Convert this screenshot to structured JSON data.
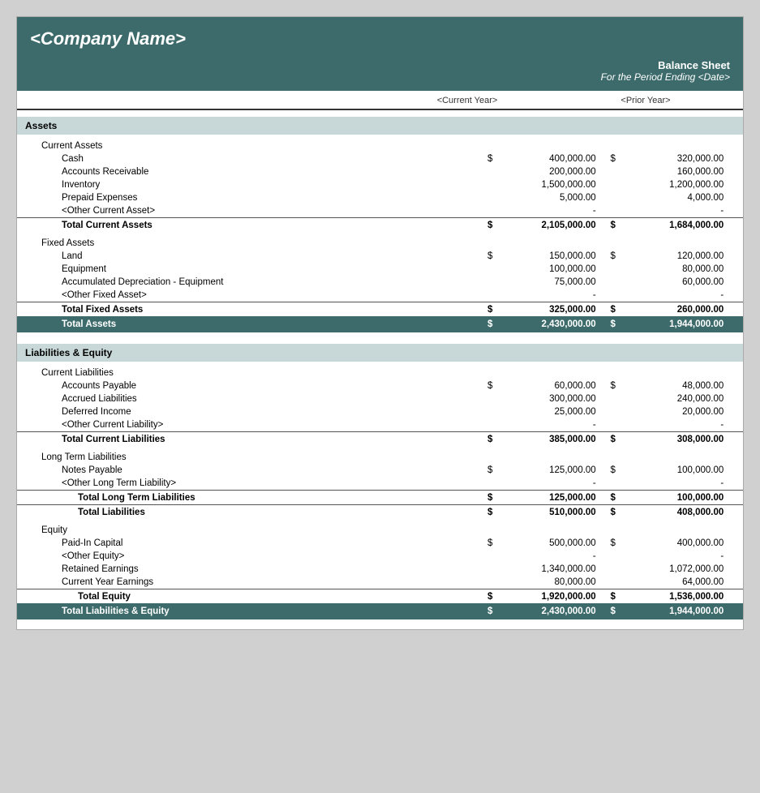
{
  "header": {
    "company_name": "<Company Name>",
    "title": "Balance Sheet",
    "subtitle": "For the Period Ending <Date>",
    "col_cy": "<Current Year>",
    "col_py": "<Prior Year>"
  },
  "sections": {
    "assets_label": "Assets",
    "liabilities_label": "Liabilities & Equity"
  },
  "assets": {
    "current_assets_label": "Current Assets",
    "items": [
      {
        "label": "Cash",
        "dollar": "$",
        "cy": "400,000.00",
        "py_dollar": "$",
        "py": "320,000.00"
      },
      {
        "label": "Accounts Receivable",
        "dollar": "",
        "cy": "200,000.00",
        "py_dollar": "",
        "py": "160,000.00"
      },
      {
        "label": "Inventory",
        "dollar": "",
        "cy": "1,500,000.00",
        "py_dollar": "",
        "py": "1,200,000.00"
      },
      {
        "label": "Prepaid Expenses",
        "dollar": "",
        "cy": "5,000.00",
        "py_dollar": "",
        "py": "4,000.00"
      },
      {
        "label": "<Other Current Asset>",
        "dollar": "",
        "cy": "-",
        "py_dollar": "",
        "py": "-"
      }
    ],
    "total_current": {
      "label": "Total Current Assets",
      "dollar": "$",
      "cy": "2,105,000.00",
      "py_dollar": "$",
      "py": "1,684,000.00"
    },
    "fixed_assets_label": "Fixed Assets",
    "fixed_items": [
      {
        "label": "Land",
        "dollar": "$",
        "cy": "150,000.00",
        "py_dollar": "$",
        "py": "120,000.00"
      },
      {
        "label": "Equipment",
        "dollar": "",
        "cy": "100,000.00",
        "py_dollar": "",
        "py": "80,000.00"
      },
      {
        "label": "Accumulated Depreciation - Equipment",
        "dollar": "",
        "cy": "75,000.00",
        "py_dollar": "",
        "py": "60,000.00"
      },
      {
        "label": "<Other Fixed Asset>",
        "dollar": "",
        "cy": "-",
        "py_dollar": "",
        "py": "-"
      }
    ],
    "total_fixed": {
      "label": "Total Fixed Assets",
      "dollar": "$",
      "cy": "325,000.00",
      "py_dollar": "$",
      "py": "260,000.00"
    },
    "total_assets": {
      "label": "Total Assets",
      "dollar": "$",
      "cy": "2,430,000.00",
      "py_dollar": "$",
      "py": "1,944,000.00"
    }
  },
  "liabilities": {
    "current_liabilities_label": "Current Liabilities",
    "current_items": [
      {
        "label": "Accounts Payable",
        "dollar": "$",
        "cy": "60,000.00",
        "py_dollar": "$",
        "py": "48,000.00"
      },
      {
        "label": "Accrued Liabilities",
        "dollar": "",
        "cy": "300,000.00",
        "py_dollar": "",
        "py": "240,000.00"
      },
      {
        "label": "Deferred Income",
        "dollar": "",
        "cy": "25,000.00",
        "py_dollar": "",
        "py": "20,000.00"
      },
      {
        "label": "<Other Current Liability>",
        "dollar": "",
        "cy": "-",
        "py_dollar": "",
        "py": "-"
      }
    ],
    "total_current": {
      "label": "Total Current Liabilities",
      "dollar": "$",
      "cy": "385,000.00",
      "py_dollar": "$",
      "py": "308,000.00"
    },
    "long_term_label": "Long Term Liabilities",
    "long_term_items": [
      {
        "label": "Notes Payable",
        "dollar": "$",
        "cy": "125,000.00",
        "py_dollar": "$",
        "py": "100,000.00"
      },
      {
        "label": "<Other Long Term Liability>",
        "dollar": "",
        "cy": "-",
        "py_dollar": "",
        "py": "-"
      }
    ],
    "total_long_term": {
      "label": "Total Long Term Liabilities",
      "dollar": "$",
      "cy": "125,000.00",
      "py_dollar": "$",
      "py": "100,000.00"
    },
    "total_liabilities": {
      "label": "Total Liabilities",
      "dollar": "$",
      "cy": "510,000.00",
      "py_dollar": "$",
      "py": "408,000.00"
    },
    "equity_label": "Equity",
    "equity_items": [
      {
        "label": "Paid-In Capital",
        "dollar": "$",
        "cy": "500,000.00",
        "py_dollar": "$",
        "py": "400,000.00"
      },
      {
        "label": "<Other Equity>",
        "dollar": "",
        "cy": "-",
        "py_dollar": "",
        "py": "-"
      },
      {
        "label": "Retained Earnings",
        "dollar": "",
        "cy": "1,340,000.00",
        "py_dollar": "",
        "py": "1,072,000.00"
      },
      {
        "label": "Current Year Earnings",
        "dollar": "",
        "cy": "80,000.00",
        "py_dollar": "",
        "py": "64,000.00"
      }
    ],
    "total_equity": {
      "label": "Total Equity",
      "dollar": "$",
      "cy": "1,920,000.00",
      "py_dollar": "$",
      "py": "1,536,000.00"
    },
    "total_liabilities_equity": {
      "label": "Total Liabilities & Equity",
      "dollar": "$",
      "cy": "2,430,000.00",
      "py_dollar": "$",
      "py": "1,944,000.00"
    }
  }
}
